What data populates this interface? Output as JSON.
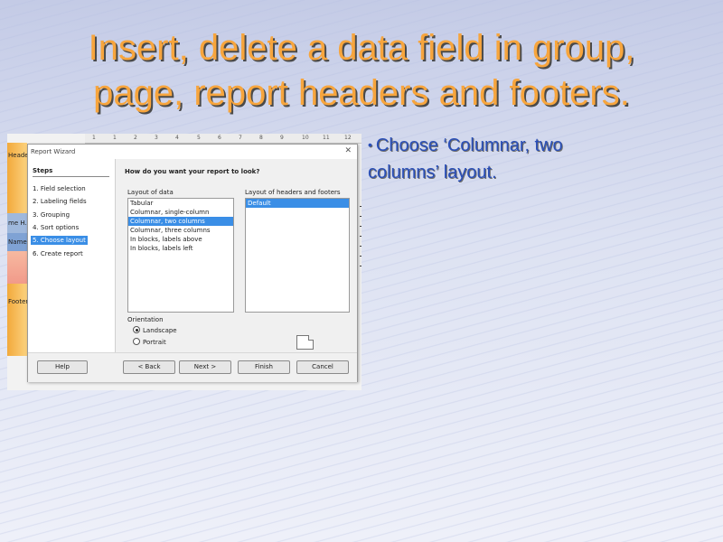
{
  "slide": {
    "title_line1": "Insert, delete a data field in group,",
    "title_line2": "page, report headers and footers.",
    "bullet": "Choose ‘Columnar, two columns’ layout."
  },
  "report_editor": {
    "ruler_ticks": [
      "1",
      "1",
      "2",
      "3",
      "4",
      "5",
      "6",
      "7",
      "8",
      "9",
      "10",
      "11",
      "12"
    ],
    "bands": [
      {
        "label": "Header",
        "color": "#f5b942"
      },
      {
        "label": "me H...",
        "color": "#9fb8dc"
      },
      {
        "label": "Name ...",
        "color": "#9fb8dc"
      },
      {
        "label": "Footer",
        "color": "#f5b942"
      }
    ]
  },
  "dialog": {
    "title": "Report Wizard",
    "close": "✕",
    "steps_header": "Steps",
    "steps": [
      {
        "label": "1. Field selection",
        "selected": false
      },
      {
        "label": "2. Labeling fields",
        "selected": false
      },
      {
        "label": "3. Grouping",
        "selected": false
      },
      {
        "label": "4. Sort options",
        "selected": false
      },
      {
        "label": "5. Choose layout",
        "selected": true
      },
      {
        "label": "6. Create report",
        "selected": false
      }
    ],
    "question": "How do you want your report to look?",
    "layout_of_data_label": "Layout of data",
    "layout_of_data": [
      {
        "label": "Tabular",
        "selected": false
      },
      {
        "label": "Columnar, single-column",
        "selected": false
      },
      {
        "label": "Columnar, two columns",
        "selected": true
      },
      {
        "label": "Columnar, three columns",
        "selected": false
      },
      {
        "label": "In blocks, labels above",
        "selected": false
      },
      {
        "label": "In blocks, labels left",
        "selected": false
      }
    ],
    "layout_headers_label": "Layout of headers and footers",
    "layout_headers": [
      {
        "label": "Default",
        "selected": true
      }
    ],
    "orientation_label": "Orientation",
    "orientation_options": [
      {
        "label": "Landscape",
        "checked": true
      },
      {
        "label": "Portrait",
        "checked": false
      }
    ],
    "buttons": {
      "help": "Help",
      "back": "< Back",
      "next": "Next >",
      "finish": "Finish",
      "cancel": "Cancel"
    }
  },
  "colors": {
    "title": "#f7a53d",
    "bullet": "#2a4fb8",
    "selection": "#3a8ee6"
  }
}
